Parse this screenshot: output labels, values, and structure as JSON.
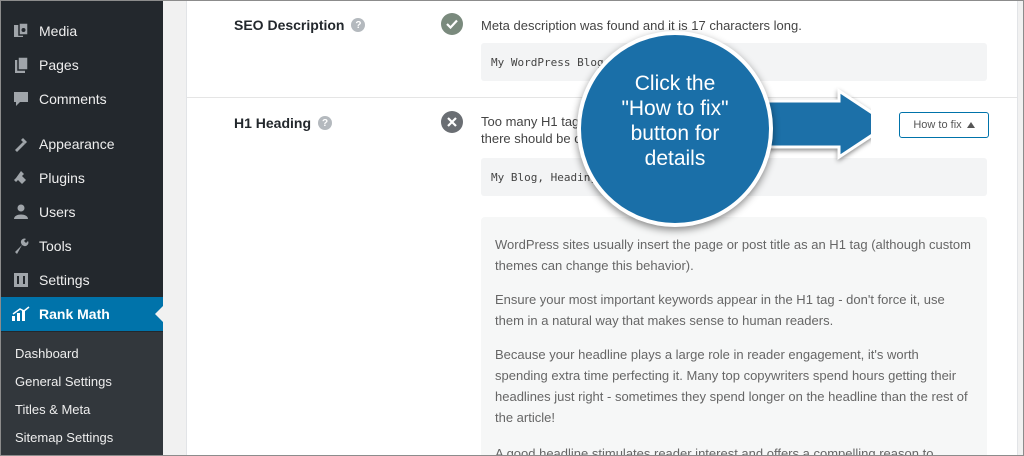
{
  "sidebar": {
    "items": [
      {
        "label": "Media",
        "icon": "media-icon"
      },
      {
        "label": "Pages",
        "icon": "pages-icon"
      },
      {
        "label": "Comments",
        "icon": "comments-icon"
      },
      {
        "label": "Appearance",
        "icon": "appearance-icon"
      },
      {
        "label": "Plugins",
        "icon": "plugins-icon"
      },
      {
        "label": "Users",
        "icon": "users-icon"
      },
      {
        "label": "Tools",
        "icon": "tools-icon"
      },
      {
        "label": "Settings",
        "icon": "settings-icon"
      },
      {
        "label": "Rank Math",
        "icon": "rank-math-icon",
        "active": true
      }
    ],
    "submenu": [
      "Dashboard",
      "General Settings",
      "Titles & Meta",
      "Sitemap Settings"
    ],
    "active_color": "#0073aa"
  },
  "seo_description": {
    "label": "SEO Description",
    "help": "?",
    "status": "pass",
    "message": "Meta description was found and it is 17 characters long.",
    "code": "My WordPress Blog"
  },
  "h1_heading": {
    "label": "H1 Heading",
    "help": "?",
    "status": "fail",
    "message_line1": "Too many H1 tags found on the page. There is a total of 2 H1 tags;",
    "message_line2": "there should be only one H1 tag on the page.",
    "code": "My Blog, Heading",
    "button_label": "How to fix",
    "howto_paragraphs": [
      "WordPress sites usually insert the page or post title as an H1 tag (although custom themes can change this behavior).",
      "Ensure your most important keywords appear in the H1 tag - don't force it, use them in a natural way that makes sense to human readers.",
      "Because your headline plays a large role in reader engagement, it's worth spending extra time perfecting it. Many top copywriters spend hours getting their headlines just right - sometimes they spend longer on the headline than the rest of the article!",
      "A good headline stimulates reader interest and offers a compelling reason to"
    ]
  },
  "callout": {
    "line1": "Click the",
    "line2": "\"How to fix\"",
    "line3": "button for",
    "line4": "details",
    "color": "#1a6fa8"
  }
}
